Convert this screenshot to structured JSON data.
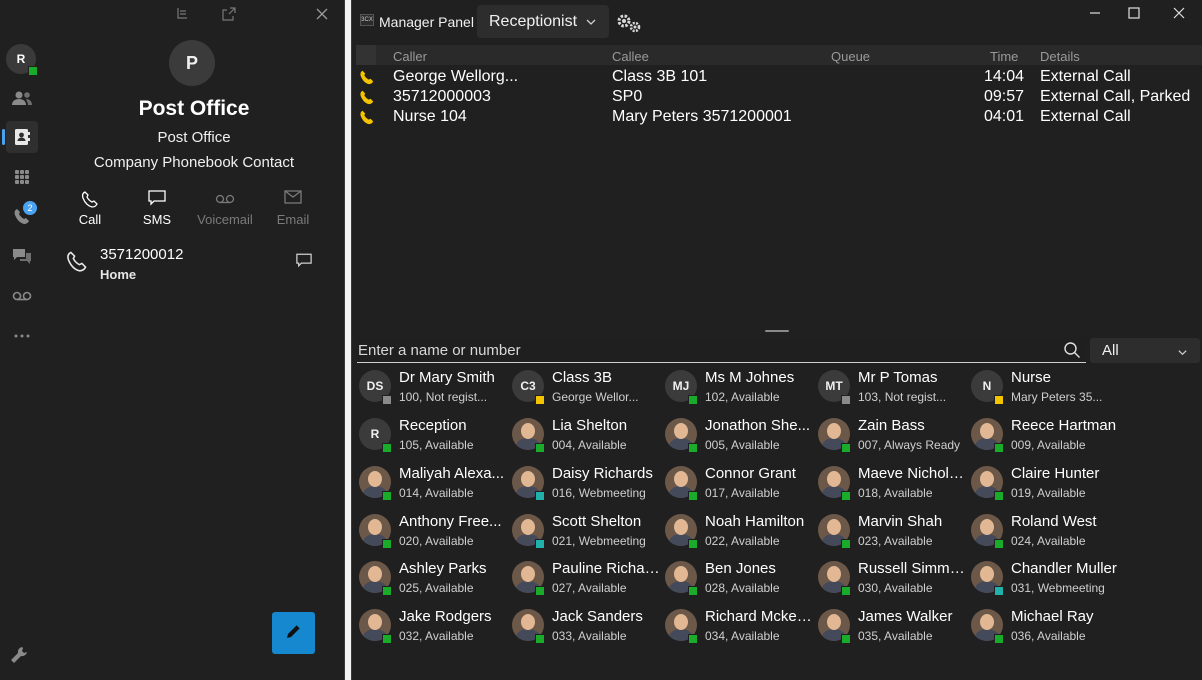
{
  "colors": {
    "available": "#1bab2b",
    "not_registered": "#8a8a8a",
    "busy_yellow": "#f4c400",
    "webmeeting": "#20b2aa",
    "accent": "#1588cf"
  },
  "left": {
    "rail_avatar_initial": "R",
    "rail_badge_count": "2",
    "contact_initial": "P",
    "contact_name": "Post Office",
    "company": "Post Office",
    "contact_type": "Company Phonebook Contact",
    "actions": {
      "call": "Call",
      "sms": "SMS",
      "voicemail": "Voicemail",
      "email": "Email"
    },
    "phone": {
      "number": "3571200012",
      "label": "Home"
    }
  },
  "right": {
    "app_title": "Manager Panel",
    "logo_text": "3CX",
    "view_selector": "Receptionist",
    "columns": {
      "caller": "Caller",
      "callee": "Callee",
      "queue": "Queue",
      "time": "Time",
      "details": "Details"
    },
    "calls": [
      {
        "caller": "George Wellorg...",
        "callee": "Class 3B 101",
        "queue": "",
        "time": "14:04",
        "details": "External Call"
      },
      {
        "caller": "35712000003",
        "callee": "SP0",
        "queue": "",
        "time": "09:57",
        "details": "External Call, Parked"
      },
      {
        "caller": "Nurse 104",
        "callee": "Mary Peters 3571200001",
        "queue": "",
        "time": "04:01",
        "details": "External Call"
      }
    ],
    "search_placeholder": "Enter a name or number",
    "filter_value": "All",
    "contacts": [
      {
        "name": "Dr Mary Smith",
        "sub": "100, Not regist...",
        "initials": "DS",
        "status": "not_registered"
      },
      {
        "name": "Class 3B",
        "sub": "George Wellor...",
        "initials": "C3",
        "status": "busy_yellow"
      },
      {
        "name": "Ms M Johnes",
        "sub": "102, Available",
        "initials": "MJ",
        "status": "available"
      },
      {
        "name": "Mr P Tomas",
        "sub": "103, Not regist...",
        "initials": "MT",
        "status": "not_registered"
      },
      {
        "name": "Nurse",
        "sub": "Mary Peters 35...",
        "initials": "N",
        "status": "busy_yellow"
      },
      {
        "name": "Reception",
        "sub": "105, Available",
        "initials": "R",
        "status": "available"
      },
      {
        "name": "Lia Shelton",
        "sub": "004, Available",
        "initials": "",
        "status": "available"
      },
      {
        "name": "Jonathon She...",
        "sub": "005, Available",
        "initials": "",
        "status": "available"
      },
      {
        "name": "Zain Bass",
        "sub": "007, Always Ready",
        "initials": "",
        "status": "available"
      },
      {
        "name": "Reece Hartman",
        "sub": "009, Available",
        "initials": "",
        "status": "available"
      },
      {
        "name": "Maliyah Alexa...",
        "sub": "014, Available",
        "initials": "",
        "status": "available"
      },
      {
        "name": "Daisy Richards",
        "sub": "016, Webmeeting",
        "initials": "",
        "status": "webmeeting"
      },
      {
        "name": "Connor Grant",
        "sub": "017, Available",
        "initials": "",
        "status": "available"
      },
      {
        "name": "Maeve Nichols...",
        "sub": "018, Available",
        "initials": "",
        "status": "available"
      },
      {
        "name": "Claire Hunter",
        "sub": "019, Available",
        "initials": "",
        "status": "available"
      },
      {
        "name": "Anthony Free...",
        "sub": "020, Available",
        "initials": "",
        "status": "available"
      },
      {
        "name": "Scott Shelton",
        "sub": "021, Webmeeting",
        "initials": "",
        "status": "webmeeting"
      },
      {
        "name": "Noah Hamilton",
        "sub": "022, Available",
        "initials": "",
        "status": "available"
      },
      {
        "name": "Marvin Shah",
        "sub": "023, Available",
        "initials": "",
        "status": "available"
      },
      {
        "name": "Roland West",
        "sub": "024, Available",
        "initials": "",
        "status": "available"
      },
      {
        "name": "Ashley Parks",
        "sub": "025, Available",
        "initials": "",
        "status": "available"
      },
      {
        "name": "Pauline Richards",
        "sub": "027, Available",
        "initials": "",
        "status": "available"
      },
      {
        "name": "Ben Jones",
        "sub": "028, Available",
        "initials": "",
        "status": "available"
      },
      {
        "name": "Russell Simmo...",
        "sub": "030, Available",
        "initials": "",
        "status": "available"
      },
      {
        "name": "Chandler Muller",
        "sub": "031, Webmeeting",
        "initials": "",
        "status": "webmeeting"
      },
      {
        "name": "Jake Rodgers",
        "sub": "032, Available",
        "initials": "",
        "status": "available"
      },
      {
        "name": "Jack Sanders",
        "sub": "033, Available",
        "initials": "",
        "status": "available"
      },
      {
        "name": "Richard Mcken...",
        "sub": "034, Available",
        "initials": "",
        "status": "available"
      },
      {
        "name": "James Walker",
        "sub": "035, Available",
        "initials": "",
        "status": "available"
      },
      {
        "name": "Michael Ray",
        "sub": "036, Available",
        "initials": "",
        "status": "available"
      }
    ]
  }
}
